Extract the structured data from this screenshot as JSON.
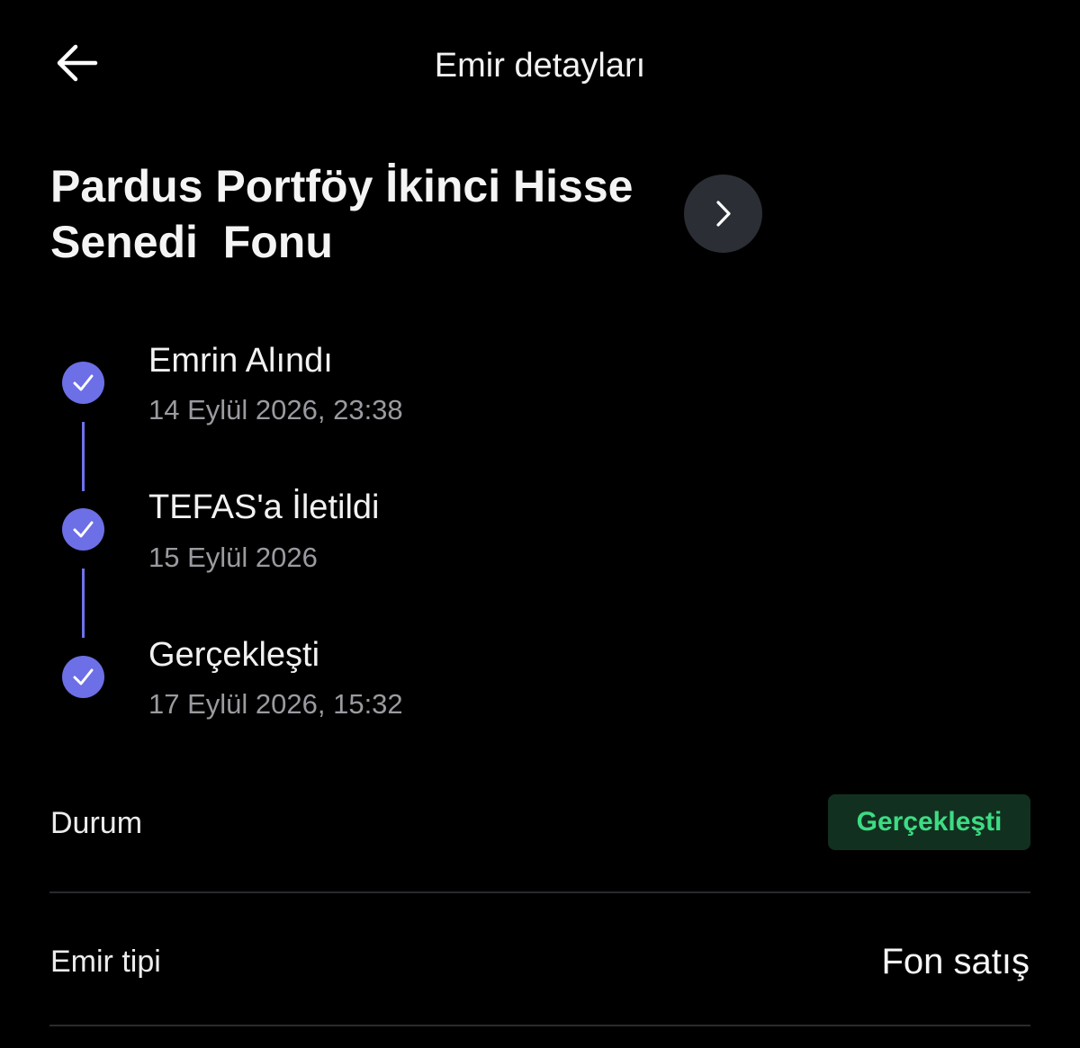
{
  "header": {
    "title": "Emir detayları",
    "back_icon": "arrow-left-icon"
  },
  "fund": {
    "name_line1": "Pardus Portföy İkinci Hisse",
    "name_line2": "Senedi  Fonu",
    "link_icon": "chevron-right-icon"
  },
  "timeline": {
    "accent_color": "#6c6fe6",
    "steps": [
      {
        "title": "Emrin Alındı",
        "date": "14 Eylül 2026, 23:38",
        "icon": "check-icon"
      },
      {
        "title": "TEFAS'a İletildi",
        "date": "15 Eylül 2026",
        "icon": "check-icon"
      },
      {
        "title": "Gerçekleşti",
        "date": "17 Eylül 2026, 15:32",
        "icon": "check-icon"
      }
    ]
  },
  "details": {
    "status": {
      "label": "Durum",
      "value": "Gerçekleşti",
      "color": "#3ddc84"
    },
    "order_type": {
      "label": "Emir tipi",
      "value": "Fon satış"
    }
  }
}
